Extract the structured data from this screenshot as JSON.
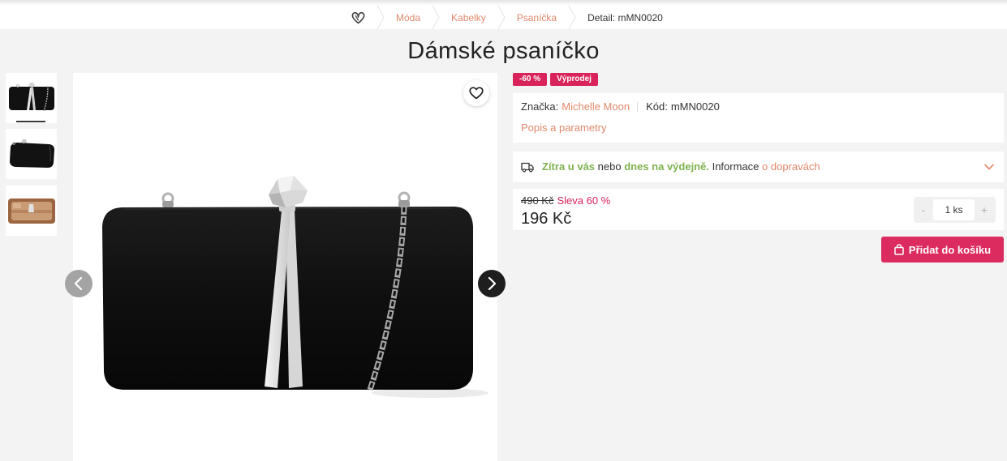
{
  "breadcrumb": {
    "items": [
      {
        "label": "Móda"
      },
      {
        "label": "Kabelky"
      },
      {
        "label": "Psaníčka"
      }
    ],
    "current": "Detail: mMN0020"
  },
  "product": {
    "title": "Dámské psaníčko",
    "badges": [
      "-60 %",
      "Výprodej"
    ],
    "brand_label": "Značka:",
    "brand": "Michelle Moon",
    "code_label": "Kód:",
    "code": "mMN0020",
    "details_link": "Popis a parametry"
  },
  "delivery": {
    "tomorrow": "Zítra u vás",
    "connector": "nebo",
    "pickup": "dnes na výdejně.",
    "info": "Informace",
    "shipping_link": "o dopravách"
  },
  "price": {
    "original": "490 Kč",
    "discount": "Sleva 60 %",
    "current": "196 Kč"
  },
  "quantity": {
    "decrease": "-",
    "value": "1 ks",
    "increase": "+"
  },
  "cart": {
    "button_label": "Přidat do košíku"
  },
  "icons": {
    "logo": "brand-logo-icon",
    "wishlist": "heart-icon",
    "gallery_prev": "chevron-left-icon",
    "gallery_next": "chevron-right-icon",
    "delivery": "truck-icon",
    "delivery_expand": "chevron-down-icon",
    "cart": "shopping-bag-icon"
  },
  "colors": {
    "accent": "#db2b5f",
    "link": "#e0886b",
    "delivery_highlight": "#7eb24f",
    "text": "#333333",
    "page_background": "#f3f3f3"
  }
}
